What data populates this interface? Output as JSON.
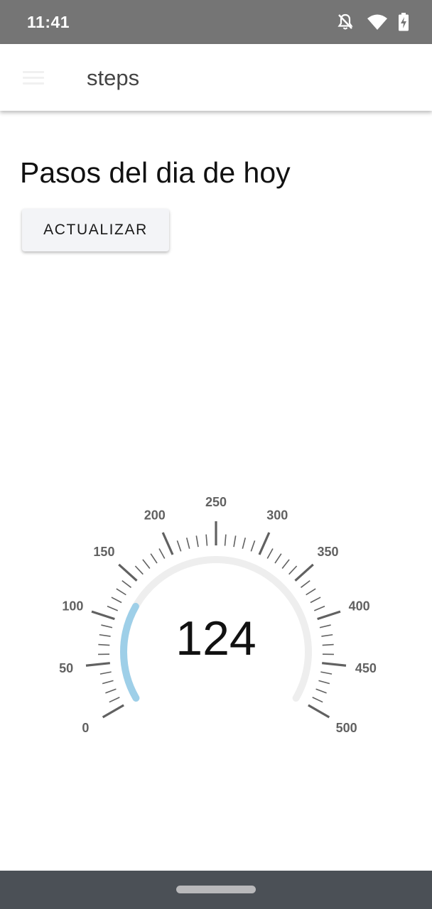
{
  "status_bar": {
    "time": "11:41",
    "icons": [
      "notifications-off-icon",
      "wifi-icon",
      "battery-charging-icon"
    ]
  },
  "app_bar": {
    "menu_icon": "menu-icon",
    "title": "steps"
  },
  "main": {
    "heading": "Pasos del dia de hoy",
    "refresh_button_label": "ACTUALIZAR"
  },
  "gauge": {
    "value": 124,
    "value_label": "124",
    "min": 0,
    "max": 500,
    "major_step": 50,
    "minor_ticks_per_major": 5,
    "tick_labels": [
      "0",
      "50",
      "100",
      "150",
      "200",
      "250",
      "300",
      "350",
      "400",
      "450",
      "500"
    ],
    "colors": {
      "progress": "#9ecfe8",
      "track": "#eeeeee",
      "ticks": "#616161",
      "labels": "#616161"
    }
  },
  "colors": {
    "status_bar": "#757575",
    "nav_bar": "#4b5056",
    "button_bg": "#f3f4f7"
  }
}
